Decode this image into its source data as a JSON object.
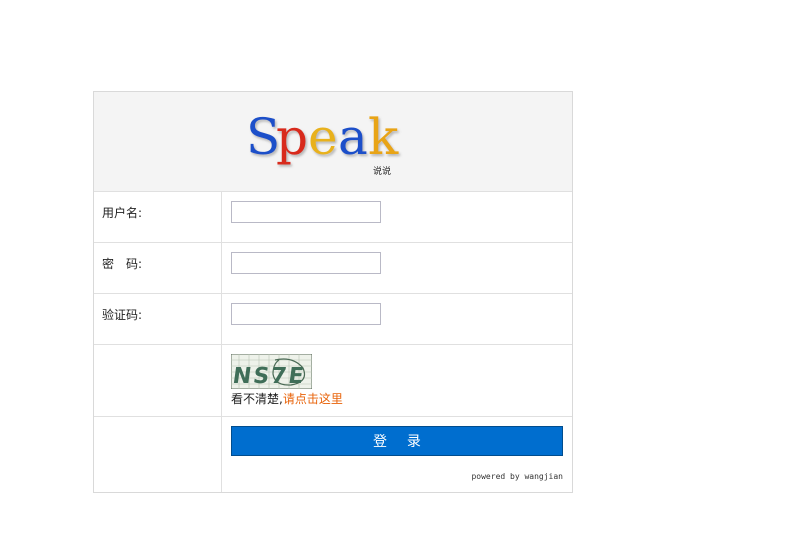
{
  "logo": {
    "text": "Speak",
    "subtitle": "说说"
  },
  "form": {
    "username_label": "用户名:",
    "password_label": "密　码:",
    "captcha_label": "验证码:",
    "username_value": "",
    "password_value": "",
    "captcha_value": ""
  },
  "captcha": {
    "image_text": "NS7E",
    "hint_text": "看不清楚,",
    "refresh_link": "请点击这里"
  },
  "login_button": "登 录",
  "powered_by": "powered by wangjian",
  "colors": {
    "button": "#006ecf",
    "link": "#e8630a"
  }
}
